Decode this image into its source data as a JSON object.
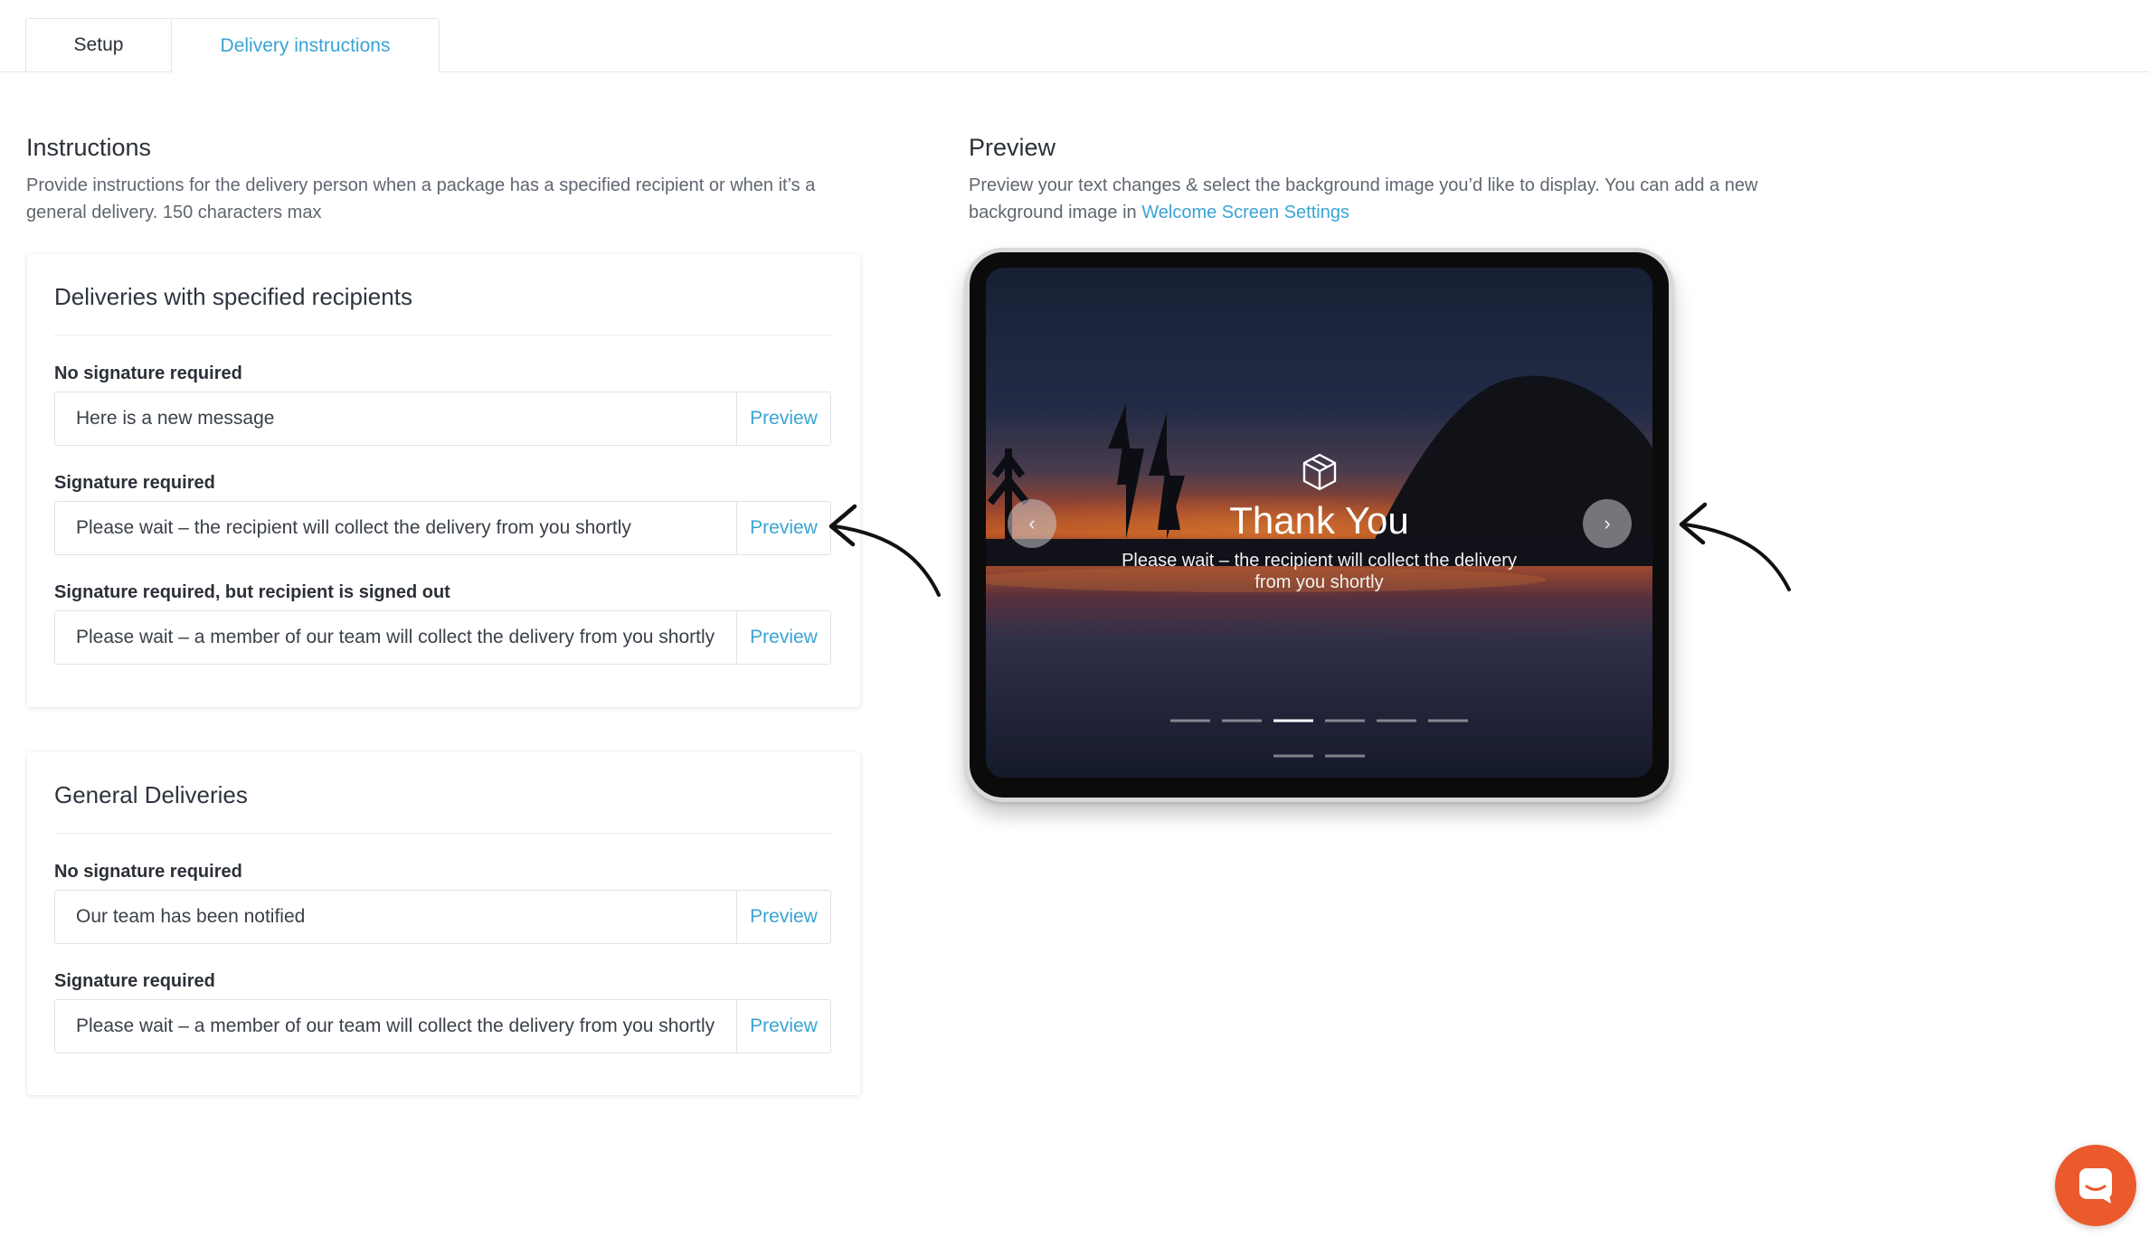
{
  "tabs": [
    {
      "label": "Setup",
      "active": false
    },
    {
      "label": "Delivery instructions",
      "active": true
    }
  ],
  "instructions": {
    "title": "Instructions",
    "description_line1": "Provide instructions for the delivery person when a package has a specified recipient or when it’s a",
    "description_line2": "general delivery. 150 characters max"
  },
  "preview_section": {
    "title": "Preview",
    "description_line1": "Preview your text changes & select the background image you’d like to display. You can add a new",
    "description_line2_prefix": "background image in ",
    "link_label": "Welcome Screen Settings"
  },
  "specified_recipients": {
    "title": "Deliveries with specified recipients",
    "fields": [
      {
        "label": "No signature required",
        "value": "Here is a new message",
        "preview_label": "Preview"
      },
      {
        "label": "Signature required",
        "value": "Please wait – the recipient will collect the delivery from you shortly",
        "preview_label": "Preview"
      },
      {
        "label": "Signature required, but recipient is signed out",
        "value": "Please wait – a member of our team will collect the delivery from you shortly",
        "preview_label": "Preview"
      }
    ]
  },
  "general_deliveries": {
    "title": "General Deliveries",
    "fields": [
      {
        "label": "No signature required",
        "value": "Our team has been notified",
        "preview_label": "Preview"
      },
      {
        "label": "Signature required",
        "value": "Please wait – a member of our team will collect the delivery from you shortly",
        "preview_label": "Preview"
      }
    ]
  },
  "tablet": {
    "title": "Thank You",
    "message_line1": "Please wait – the recipient will collect the delivery",
    "message_line2": "from you shortly",
    "prev_glyph": "‹",
    "next_glyph": "›",
    "carousel_dots_total": 8,
    "carousel_active_index": 2
  },
  "icons": {
    "box": "package-box-icon",
    "prev": "chevron-left-icon",
    "next": "chevron-right-icon",
    "chat": "chat-bubble-icon",
    "annotation": "curved-arrow-icon"
  },
  "colors": {
    "accent": "#3aa3d4",
    "chat": "#ea5a2d",
    "text": "#2b3038",
    "muted": "#5f6670"
  }
}
